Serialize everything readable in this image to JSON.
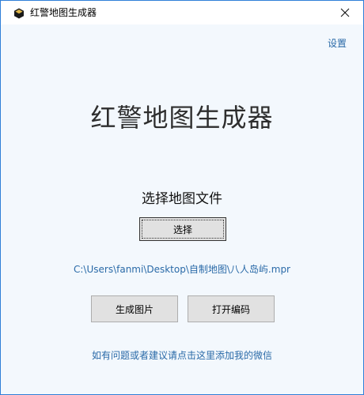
{
  "window": {
    "title": "红警地图生成器",
    "close_icon": "close-icon",
    "app_icon": "hexagon-app-icon"
  },
  "header": {
    "settings_label": "设置"
  },
  "main": {
    "heading": "红警地图生成器",
    "select_label": "选择地图文件",
    "select_button": "选择",
    "file_path": "C:\\Users\\fanmi\\Desktop\\自制地图\\八人岛屿.mpr",
    "generate_button": "生成图片",
    "open_code_button": "打开编码",
    "feedback_link": "如有问题或者建议请点击这里添加我的微信"
  },
  "colors": {
    "accent_link": "#2a6aa8",
    "window_border": "#2f7fd8",
    "client_background": "#f3f8fd",
    "button_face": "#e1e1e1"
  }
}
